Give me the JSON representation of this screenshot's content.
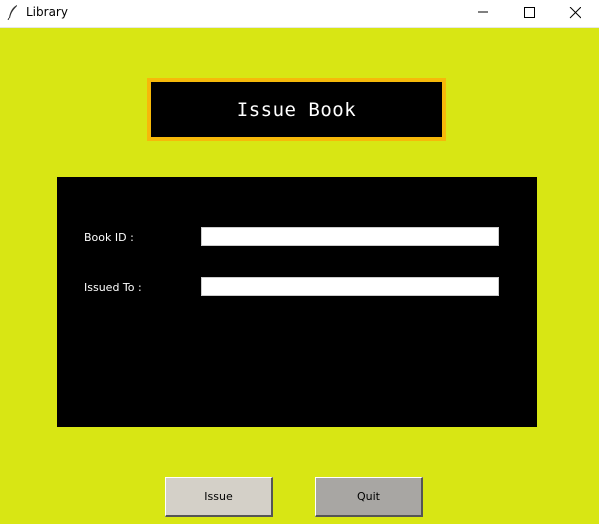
{
  "window": {
    "title": "Library",
    "icon": "feather-icon",
    "controls": [
      "minimize-icon",
      "maximize-icon",
      "close-icon"
    ]
  },
  "heading": {
    "text": "Issue Book"
  },
  "form": {
    "book_id_label": "Book ID :",
    "book_id_value": "",
    "issued_to_label": "Issued To :",
    "issued_to_value": ""
  },
  "buttons": {
    "issue_label": "Issue",
    "quit_label": "Quit"
  },
  "colors": {
    "background": "#d8e614",
    "heading_border": "#f6b90a",
    "panel": "#000000",
    "issue_button": "#d4d0c8",
    "quit_button": "#a8a6a3"
  }
}
